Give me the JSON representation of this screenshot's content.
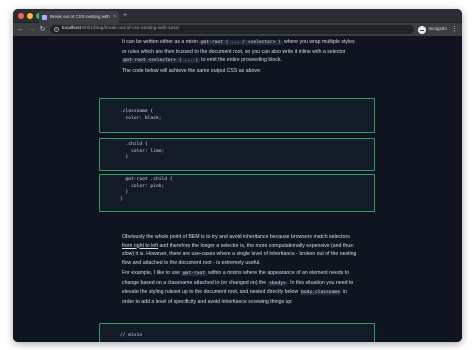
{
  "browser": {
    "tab_title": "Break out of CSS nesting with …",
    "tab_close": "×",
    "new_tab": "+",
    "url_host": "localhost",
    "url_path": ":8001/blog/break-out-of-css-nesting-with-sass/",
    "incognito_label": "Incognito",
    "back": "←",
    "forward": "→",
    "reload": "↻",
    "menu": "⋮"
  },
  "article": {
    "p1": {
      "a": "It can be written either as a mixin ",
      "code1": "@at-root ( ... / <selector> )",
      "b": " where you wrap multiple styles or rules which are then trussed to the document root, so you can also write it inline with a selector ",
      "code2": "@at-root <selector> ( ... )",
      "c": " to emit the entire proceeding block."
    },
    "p2": "The code below will achieve the same output CSS as above:",
    "code_blocks": [
      ".classname {\n  color: black;",
      "  .child {\n    color: lime;\n  }",
      "  @at-root .child {\n    color: pink;\n  }\n}"
    ],
    "p3": {
      "a": "Obviously the whole point of BEM is to try and avoid inheritance because browsers match selectors ",
      "link": "from right to left",
      "b": " and therefore the longer a selector is, the more computationally expensive (and thus: slow) it is. However, there are use-cases where a single level of inheritance - broken out of the nesting flow and attached to the document root - is extremely useful."
    },
    "p4": {
      "a": "For example, I like to use ",
      "code1": "@at-root",
      "b": " within a mixins where the appearance of an element needs to change based on a classname attached to (or changed on) the ",
      "code2": "<body>",
      "c": ". In this situation you need to elevate the styling ruleset up to the document root, and nested directly below ",
      "code3": "body.classname",
      "d": " in order to add a level of specificity and avoid inheritance screwing things up:"
    },
    "code_block_4": "// mixin"
  },
  "colors": {
    "page_bg": "#0f1420",
    "code_border": "#2e9f63",
    "traffic_red": "#ff5f57",
    "traffic_yellow": "#febc2e",
    "traffic_green": "#28c840"
  }
}
